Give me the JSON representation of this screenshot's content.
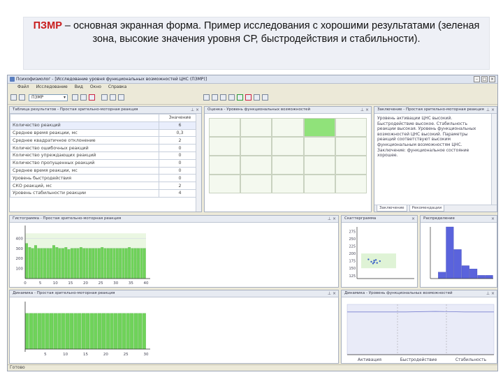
{
  "caption": {
    "highlight": "ПЗМР",
    "text": " – основная экранная форма. Пример исследования с хорошими результатами (зеленая зона, высокие значения уровня СР, быстродействия и стабильности)."
  },
  "app": {
    "title": "Психофизиолог - [Исследование уровня функциональных возможностей ЦНС (ПЗМР)]",
    "menu": [
      "Файл",
      "Исследование",
      "Вид",
      "Окно",
      "Справка"
    ],
    "toolbar_combo": "ПЗМР",
    "status": "Готово"
  },
  "results_panel": {
    "title": "Таблица результатов - Простая зрительно-моторная реакция",
    "value_header": "Значение",
    "rows": [
      {
        "label": "Количество реакций",
        "value": "6"
      },
      {
        "label": "Среднее время реакции, мс",
        "value": "0,3"
      },
      {
        "label": "Среднее квадратичное отклонение",
        "value": "2"
      },
      {
        "label": "Количество ошибочных реакций",
        "value": "0"
      },
      {
        "label": "Количество упреждающих реакций",
        "value": "0"
      },
      {
        "label": "Количество пропущенных реакций",
        "value": "0"
      },
      {
        "label": "Среднее время реакции, мс",
        "value": "0"
      },
      {
        "label": "Уровень быстродействия",
        "value": "0"
      },
      {
        "label": "СКО реакций, мс",
        "value": "2"
      },
      {
        "label": "Уровень стабильности реакции",
        "value": "4"
      }
    ]
  },
  "zone_panel": {
    "title": "Оценка - Уровень функциональных возможностей"
  },
  "conclusion_panel": {
    "title": "Заключение - Простая зрительно-моторная реакция",
    "text": "Уровень активации ЦНС высокий. Быстродействие высокое. Стабильность реакции высокая. Уровень функциональных возможностей ЦНС высокий. Параметры реакций соответствуют высоким функциональным возможностям ЦНС. Заключение: функциональное состояние хорошее.",
    "tabs": [
      "Заключение",
      "Рекомендации"
    ]
  },
  "histogram_chart": {
    "title": "Гистограмма - Простая зрительно-моторная реакция",
    "chart_data": {
      "type": "bar",
      "x": [
        0,
        5,
        10,
        15,
        20,
        25,
        30,
        35,
        40
      ],
      "yticks": [
        100,
        200,
        300,
        400
      ],
      "values": [
        350,
        310,
        300,
        330,
        300,
        300,
        300,
        300,
        300,
        330,
        310,
        300,
        300,
        310,
        290,
        300,
        300,
        300,
        310,
        300,
        300,
        300,
        300,
        300,
        300,
        310,
        300,
        300,
        300,
        300,
        300,
        300,
        300,
        300,
        310,
        300,
        300,
        300,
        300,
        300
      ],
      "ylim": [
        0,
        500
      ],
      "xlim": [
        0,
        40
      ]
    }
  },
  "scatter_chart": {
    "title": "Скаттерграмма",
    "chart_data": {
      "type": "scatter",
      "yticks": [
        125,
        150,
        175,
        200,
        225,
        250,
        275
      ],
      "ylim": [
        115,
        290
      ],
      "points": [
        [
          0.2,
          180
        ],
        [
          0.25,
          172
        ],
        [
          0.3,
          176
        ],
        [
          0.35,
          168
        ],
        [
          0.3,
          170
        ],
        [
          0.28,
          166
        ],
        [
          0.33,
          178
        ],
        [
          0.4,
          174
        ]
      ]
    }
  },
  "distribution_chart": {
    "title": "Распределение",
    "chart_data": {
      "type": "bar",
      "values": [
        0,
        2,
        16,
        9,
        4,
        3,
        1,
        1
      ],
      "ylim": [
        0,
        16
      ]
    }
  },
  "bottom_left_chart": {
    "title": "Динамика - Простая зрительно-моторная реакция",
    "chart_data": {
      "type": "bar",
      "values": [
        4,
        4,
        4,
        4,
        4,
        4,
        4,
        4,
        4,
        4,
        4,
        4,
        4,
        4,
        4,
        4,
        4,
        4,
        4,
        4,
        4,
        4,
        4,
        4,
        4,
        4,
        4,
        4,
        4,
        4
      ],
      "ylim": [
        0,
        5
      ],
      "xticks": [
        5,
        10,
        15,
        20,
        25,
        30
      ]
    }
  },
  "bottom_right_chart": {
    "title": "Динамика - Уровень функциональных возможностей",
    "chart_data": {
      "type": "area",
      "values": [
        0.85,
        0.85,
        0.85,
        0.86,
        0.85,
        0.85
      ],
      "xlabels": [
        "Активация",
        "Быстродействие",
        "Стабильность"
      ]
    }
  }
}
